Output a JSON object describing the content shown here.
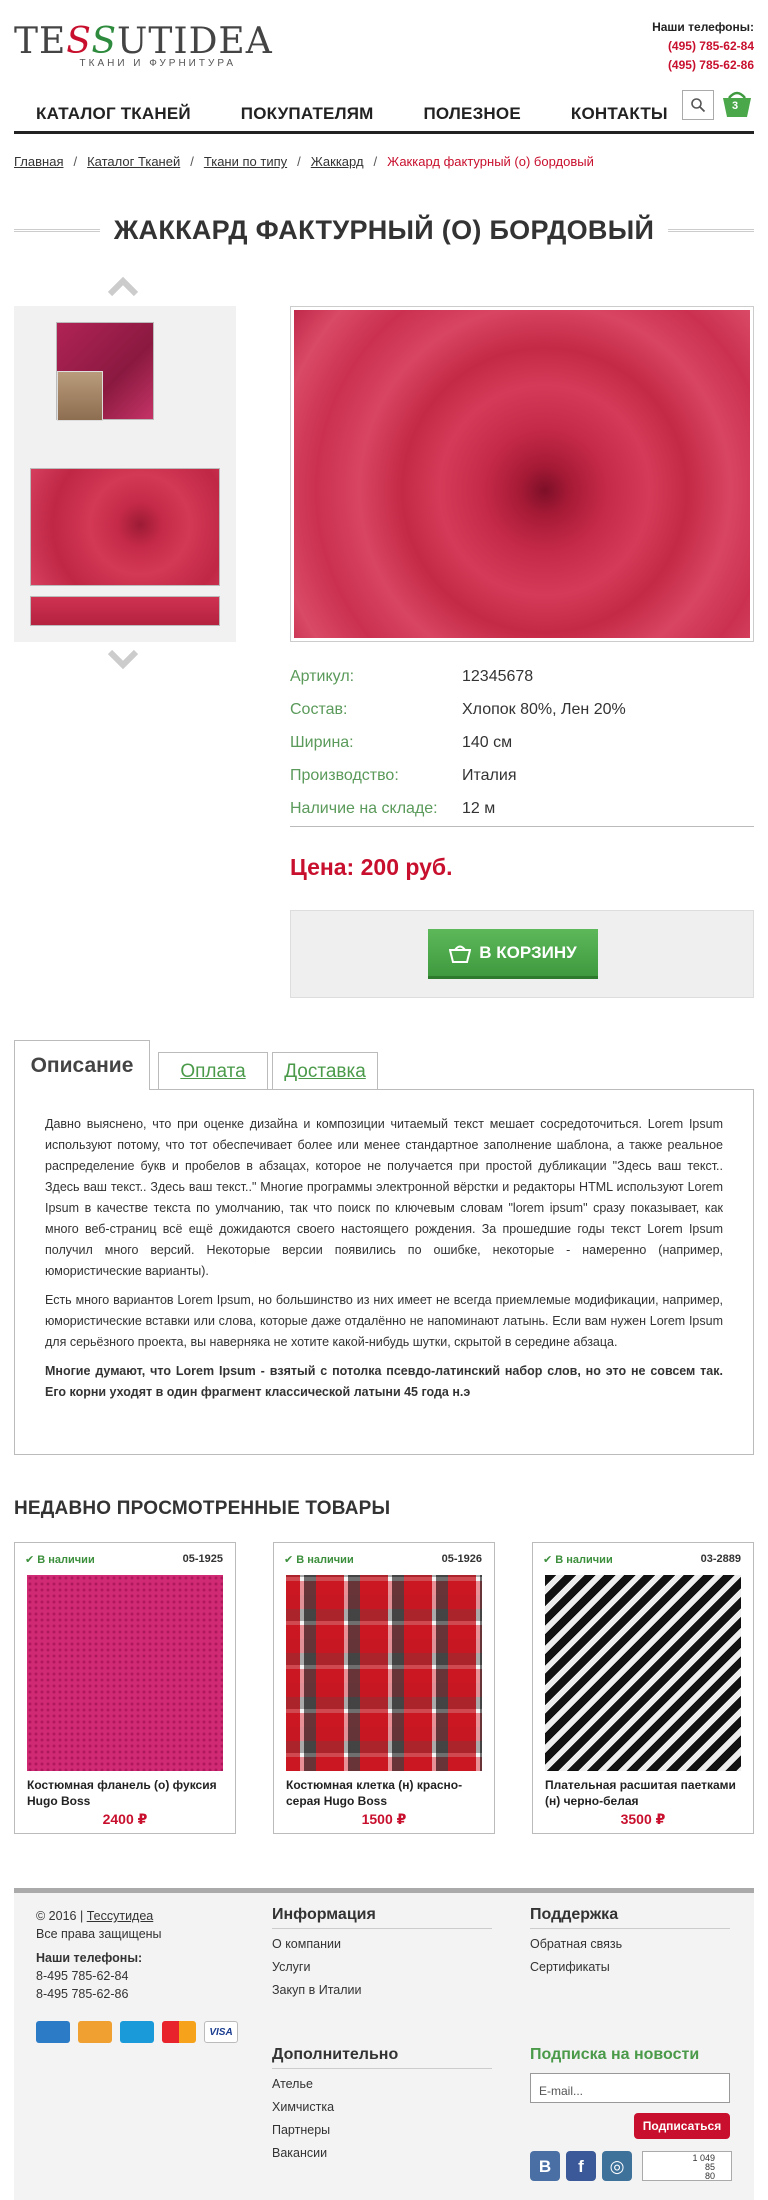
{
  "header": {
    "logo_text": "TESSUTIDEA",
    "logo_subtitle": "ТКАНИ И ФУРНИТУРА",
    "phones_label": "Наши телефоны:",
    "phones": [
      "(495) 785-62-84",
      "(495) 785-62-86"
    ],
    "menu": [
      "КАТАЛОГ ТКАНЕЙ",
      "ПОКУПАТЕЛЯМ",
      "ПОЛЕЗНОЕ",
      "КОНТАКТЫ"
    ],
    "cart_count": "3",
    "search_icon": "search-icon",
    "cart_icon": "basket-icon"
  },
  "breadcrumbs": {
    "items": [
      "Главная",
      "Каталог Тканей",
      "Ткани по типу",
      "Жаккард"
    ],
    "current": "Жаккард фактурный (о) бордовый",
    "separator": "/"
  },
  "product": {
    "title": "ЖАККАРД ФАКТУРНЫЙ (О) БОРДОВЫЙ",
    "specs": [
      {
        "key": "Артикул:",
        "value": "12345678"
      },
      {
        "key": "Состав:",
        "value": "Хлопок 80%, Лен 20%"
      },
      {
        "key": "Ширина:",
        "value": "140 см"
      },
      {
        "key": "Производство:",
        "value": "Италия"
      },
      {
        "key": "Наличие на складе:",
        "value": "12 м"
      }
    ],
    "price": "Цена: 200 руб.",
    "buy_label": "В КОРЗИНУ"
  },
  "tabs": {
    "items": [
      "Описание",
      "Оплата",
      "Доставка"
    ],
    "active": "Описание",
    "description": [
      "Давно выяснено, что при оценке дизайна и композиции читаемый текст мешает сосредоточиться. Lorem Ipsum используют потому, что тот обеспечивает более или менее стандартное заполнение шаблона, а также реальное распределение букв и пробелов в абзацах, которое не получается при простой дубликации \"Здесь ваш текст.. Здесь ваш текст.. Здесь ваш текст..\" Многие программы электронной вёрстки и редакторы HTML используют Lorem Ipsum в качестве текста по умолчанию, так что поиск по ключевым словам \"lorem ipsum\" сразу показывает, как много веб-страниц всё ещё дожидаются своего настоящего рождения. За прошедшие годы текст Lorem Ipsum получил много версий. Некоторые версии появились по ошибке, некоторые - намеренно (например, юмористические варианты).",
      "Есть много вариантов Lorem Ipsum, но большинство из них имеет не всегда приемлемые модификации, например, юмористические вставки или слова, которые даже отдалённо не напоминают латынь. Если вам нужен Lorem Ipsum для серьёзного проекта, вы наверняка не хотите какой-нибудь шутки, скрытой в середине абзаца.",
      "Многие думают, что Lorem Ipsum - взятый с потолка псевдо-латинский набор слов, но это не совсем так. Его корни уходят в один фрагмент классической латыни 45 года н.э"
    ]
  },
  "recent": {
    "title": "НЕДАВНО ПРОСМОТРЕННЫЕ ТОВАРЫ",
    "items": [
      {
        "stock": "В наличии",
        "code": "05-1925",
        "name": "Костюмная фланель (о) фуксия Hugo Boss",
        "price": "2400 ₽"
      },
      {
        "stock": "В наличии",
        "code": "05-1926",
        "name": "Костюмная клетка (н) красно-серая Hugo Boss",
        "price": "1500 ₽"
      },
      {
        "stock": "В наличии",
        "code": "03-2889",
        "name": "Плательная расшитая паетками (н) черно-белая",
        "price": "3500 ₽"
      }
    ]
  },
  "footer": {
    "copyright": "© 2016 |",
    "brand_link": "Тессутидеа",
    "rights": "Все права защищены",
    "phones_label": "Наши телефоны:",
    "phones": [
      "8-495 785-62-84",
      "8-495 785-62-86"
    ],
    "info_title": "Информация",
    "info_links": [
      "О компании",
      "Услуги",
      "Закуп в Италии"
    ],
    "extra_title": "Дополнительно",
    "extra_links": [
      "Ателье",
      "Химчистка",
      "Партнеры",
      "Вакансии"
    ],
    "support_title": "Поддержка",
    "support_links": [
      "Обратная связь",
      "Сертификаты"
    ],
    "subscribe_title": "Подписка на новости",
    "email_placeholder": "E-mail...",
    "subscribe_button": "Подписаться",
    "payment_label": "VISA",
    "counter_lines": [
      "1 049",
      "85",
      "80"
    ],
    "colors": {
      "accent_red": "#c8102e",
      "accent_green": "#4a9a4a"
    }
  }
}
